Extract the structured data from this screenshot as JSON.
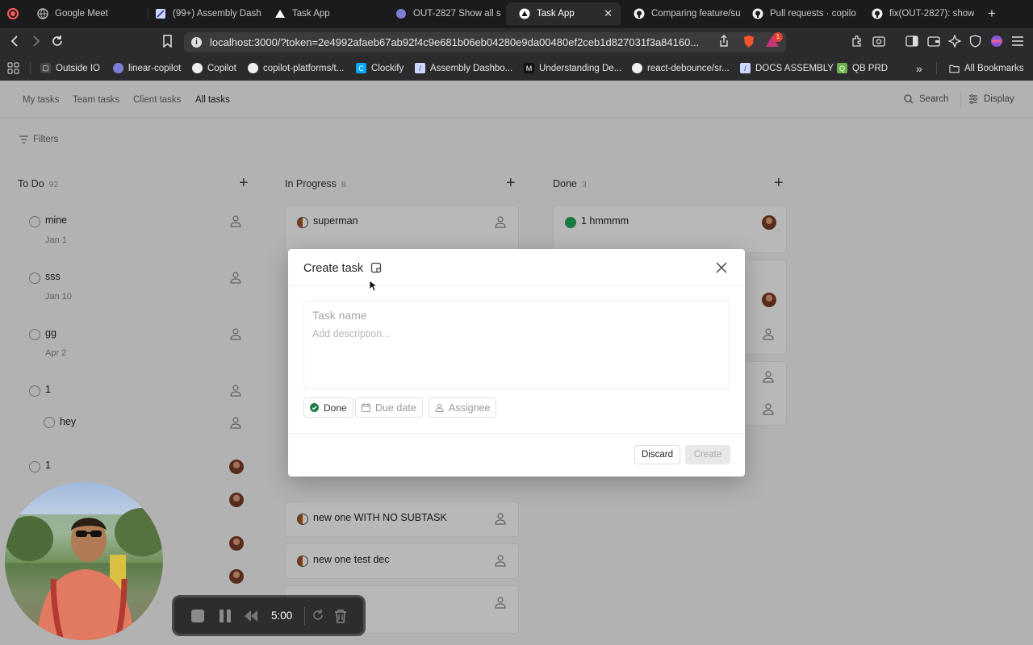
{
  "browser": {
    "tabs": [
      {
        "title": "Google Meet",
        "icon": "globe-icon",
        "active": false
      },
      {
        "title": "(99+) Assembly Dash",
        "icon": "assembly-icon",
        "active": false
      },
      {
        "title": "Task App",
        "icon": "triangle-icon",
        "active": false
      },
      {
        "title": "OUT-2827 Show all s",
        "icon": "linear-icon",
        "active": false
      },
      {
        "title": "Task App",
        "icon": "triangle-icon",
        "active": true
      },
      {
        "title": "Comparing feature/su",
        "icon": "github-icon",
        "active": false
      },
      {
        "title": "Pull requests · copilo",
        "icon": "github-icon",
        "active": false
      },
      {
        "title": "fix(OUT-2827): show",
        "icon": "github-icon",
        "active": false
      }
    ],
    "new_tab": "+",
    "url": "localhost:3000/?token=2e4992afaeb67ab92f4c9e681b06eb04280e9da00480ef2ceb1d827031f3a84160...",
    "bookmarks": [
      {
        "label": "Outside IO",
        "icon": "outside-io-icon"
      },
      {
        "label": "linear-copilot",
        "icon": "linear-icon"
      },
      {
        "label": "Copilot",
        "icon": "github-icon"
      },
      {
        "label": "copilot-platforms/t...",
        "icon": "github-icon"
      },
      {
        "label": "Clockify",
        "icon": "clockify-icon"
      },
      {
        "label": "Assembly Dashbo...",
        "icon": "assembly-icon"
      },
      {
        "label": "Understanding De...",
        "icon": "medium-icon"
      },
      {
        "label": "react-debounce/sr...",
        "icon": "github-icon"
      },
      {
        "label": "DOCS ASSEMBLY",
        "icon": "assembly-icon"
      },
      {
        "label": "QB PRD",
        "icon": "qb-icon"
      }
    ],
    "bookmarks_overflow": "»",
    "all_bookmarks": "All Bookmarks",
    "notification_count": "1",
    "colors": {
      "tabbar": "#1b1b1d",
      "toolbar": "#2b2b2e",
      "url_box": "#3b3b3e"
    }
  },
  "app": {
    "view_tabs": [
      "My tasks",
      "Team tasks",
      "Client tasks",
      "All tasks"
    ],
    "active_view": "All tasks",
    "search_label": "Search",
    "display_label": "Display",
    "filters_label": "Filters",
    "columns": [
      {
        "title": "To Do",
        "count": "92",
        "cards": [
          {
            "title": "mine",
            "sub": "Jan 1",
            "status": "todo",
            "assignee": "none"
          },
          {
            "title": "sss",
            "sub": "Jan 10",
            "status": "todo",
            "assignee": "none"
          },
          {
            "title": "gg",
            "sub": "Apr 2",
            "status": "todo",
            "assignee": "none"
          },
          {
            "title": "1",
            "sub": "",
            "status": "todo",
            "assignee": "none"
          },
          {
            "title": "hey",
            "sub": "",
            "status": "todo",
            "assignee": "none"
          },
          {
            "title": "1",
            "sub": "",
            "status": "todo",
            "assignee": "avatar"
          }
        ]
      },
      {
        "title": "In Progress",
        "count": "8",
        "cards": [
          {
            "title": "superman",
            "sub": "",
            "status": "in-progress",
            "assignee": "none"
          },
          {
            "title": "new one WITH NO SUBTASK",
            "sub": "",
            "status": "in-progress",
            "assignee": "none"
          },
          {
            "title": "new one test dec",
            "sub": "",
            "status": "in-progress",
            "assignee": "none"
          }
        ]
      },
      {
        "title": "Done",
        "count": "3",
        "cards": [
          {
            "title": "1 hmmmm",
            "sub": "",
            "status": "done",
            "assignee": "avatar"
          }
        ]
      }
    ],
    "colors": {
      "in_progress": "#b5541c",
      "done": "#23a55a"
    }
  },
  "modal": {
    "title": "Create task",
    "task_name_placeholder": "Task name",
    "description_placeholder": "Add description...",
    "status_chip": "Done",
    "due_date_chip": "Due date",
    "assignee_chip": "Assignee",
    "discard": "Discard",
    "create": "Create"
  },
  "recorder": {
    "time": "5:00"
  }
}
